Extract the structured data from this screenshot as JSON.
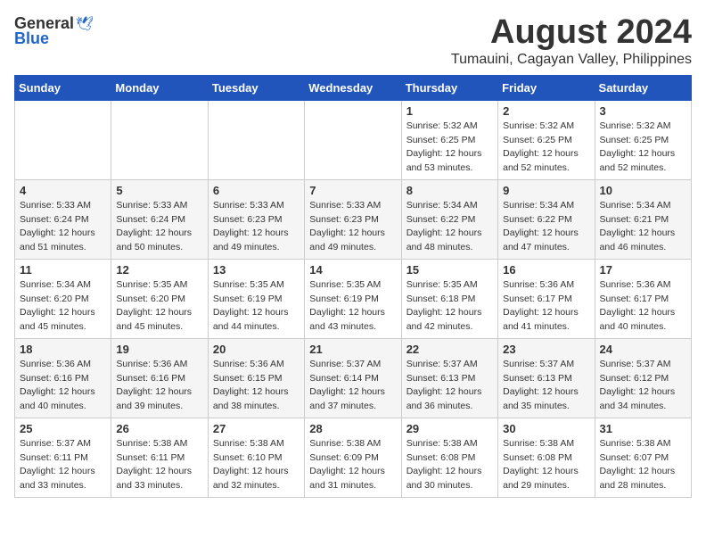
{
  "header": {
    "logo_general": "General",
    "logo_blue": "Blue",
    "title": "August 2024",
    "location": "Tumauini, Cagayan Valley, Philippines"
  },
  "calendar": {
    "days_of_week": [
      "Sunday",
      "Monday",
      "Tuesday",
      "Wednesday",
      "Thursday",
      "Friday",
      "Saturday"
    ],
    "weeks": [
      [
        {
          "day": "",
          "info": ""
        },
        {
          "day": "",
          "info": ""
        },
        {
          "day": "",
          "info": ""
        },
        {
          "day": "",
          "info": ""
        },
        {
          "day": "1",
          "info": "Sunrise: 5:32 AM\nSunset: 6:25 PM\nDaylight: 12 hours\nand 53 minutes."
        },
        {
          "day": "2",
          "info": "Sunrise: 5:32 AM\nSunset: 6:25 PM\nDaylight: 12 hours\nand 52 minutes."
        },
        {
          "day": "3",
          "info": "Sunrise: 5:32 AM\nSunset: 6:25 PM\nDaylight: 12 hours\nand 52 minutes."
        }
      ],
      [
        {
          "day": "4",
          "info": "Sunrise: 5:33 AM\nSunset: 6:24 PM\nDaylight: 12 hours\nand 51 minutes."
        },
        {
          "day": "5",
          "info": "Sunrise: 5:33 AM\nSunset: 6:24 PM\nDaylight: 12 hours\nand 50 minutes."
        },
        {
          "day": "6",
          "info": "Sunrise: 5:33 AM\nSunset: 6:23 PM\nDaylight: 12 hours\nand 49 minutes."
        },
        {
          "day": "7",
          "info": "Sunrise: 5:33 AM\nSunset: 6:23 PM\nDaylight: 12 hours\nand 49 minutes."
        },
        {
          "day": "8",
          "info": "Sunrise: 5:34 AM\nSunset: 6:22 PM\nDaylight: 12 hours\nand 48 minutes."
        },
        {
          "day": "9",
          "info": "Sunrise: 5:34 AM\nSunset: 6:22 PM\nDaylight: 12 hours\nand 47 minutes."
        },
        {
          "day": "10",
          "info": "Sunrise: 5:34 AM\nSunset: 6:21 PM\nDaylight: 12 hours\nand 46 minutes."
        }
      ],
      [
        {
          "day": "11",
          "info": "Sunrise: 5:34 AM\nSunset: 6:20 PM\nDaylight: 12 hours\nand 45 minutes."
        },
        {
          "day": "12",
          "info": "Sunrise: 5:35 AM\nSunset: 6:20 PM\nDaylight: 12 hours\nand 45 minutes."
        },
        {
          "day": "13",
          "info": "Sunrise: 5:35 AM\nSunset: 6:19 PM\nDaylight: 12 hours\nand 44 minutes."
        },
        {
          "day": "14",
          "info": "Sunrise: 5:35 AM\nSunset: 6:19 PM\nDaylight: 12 hours\nand 43 minutes."
        },
        {
          "day": "15",
          "info": "Sunrise: 5:35 AM\nSunset: 6:18 PM\nDaylight: 12 hours\nand 42 minutes."
        },
        {
          "day": "16",
          "info": "Sunrise: 5:36 AM\nSunset: 6:17 PM\nDaylight: 12 hours\nand 41 minutes."
        },
        {
          "day": "17",
          "info": "Sunrise: 5:36 AM\nSunset: 6:17 PM\nDaylight: 12 hours\nand 40 minutes."
        }
      ],
      [
        {
          "day": "18",
          "info": "Sunrise: 5:36 AM\nSunset: 6:16 PM\nDaylight: 12 hours\nand 40 minutes."
        },
        {
          "day": "19",
          "info": "Sunrise: 5:36 AM\nSunset: 6:16 PM\nDaylight: 12 hours\nand 39 minutes."
        },
        {
          "day": "20",
          "info": "Sunrise: 5:36 AM\nSunset: 6:15 PM\nDaylight: 12 hours\nand 38 minutes."
        },
        {
          "day": "21",
          "info": "Sunrise: 5:37 AM\nSunset: 6:14 PM\nDaylight: 12 hours\nand 37 minutes."
        },
        {
          "day": "22",
          "info": "Sunrise: 5:37 AM\nSunset: 6:13 PM\nDaylight: 12 hours\nand 36 minutes."
        },
        {
          "day": "23",
          "info": "Sunrise: 5:37 AM\nSunset: 6:13 PM\nDaylight: 12 hours\nand 35 minutes."
        },
        {
          "day": "24",
          "info": "Sunrise: 5:37 AM\nSunset: 6:12 PM\nDaylight: 12 hours\nand 34 minutes."
        }
      ],
      [
        {
          "day": "25",
          "info": "Sunrise: 5:37 AM\nSunset: 6:11 PM\nDaylight: 12 hours\nand 33 minutes."
        },
        {
          "day": "26",
          "info": "Sunrise: 5:38 AM\nSunset: 6:11 PM\nDaylight: 12 hours\nand 33 minutes."
        },
        {
          "day": "27",
          "info": "Sunrise: 5:38 AM\nSunset: 6:10 PM\nDaylight: 12 hours\nand 32 minutes."
        },
        {
          "day": "28",
          "info": "Sunrise: 5:38 AM\nSunset: 6:09 PM\nDaylight: 12 hours\nand 31 minutes."
        },
        {
          "day": "29",
          "info": "Sunrise: 5:38 AM\nSunset: 6:08 PM\nDaylight: 12 hours\nand 30 minutes."
        },
        {
          "day": "30",
          "info": "Sunrise: 5:38 AM\nSunset: 6:08 PM\nDaylight: 12 hours\nand 29 minutes."
        },
        {
          "day": "31",
          "info": "Sunrise: 5:38 AM\nSunset: 6:07 PM\nDaylight: 12 hours\nand 28 minutes."
        }
      ]
    ]
  }
}
